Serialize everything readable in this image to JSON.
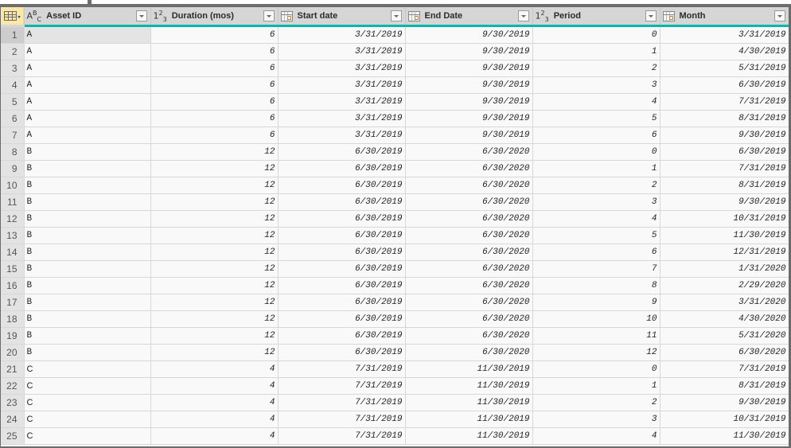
{
  "columns": [
    {
      "name": "Asset ID",
      "type_icon": "text-type-icon",
      "type_label": "ABC"
    },
    {
      "name": "Duration (mos)",
      "type_icon": "whole-number-type-icon",
      "type_label": "123"
    },
    {
      "name": "Start date",
      "type_icon": "date-type-icon",
      "type_label": ""
    },
    {
      "name": "End Date",
      "type_icon": "date-type-icon",
      "type_label": ""
    },
    {
      "name": "Period",
      "type_icon": "whole-number-type-icon",
      "type_label": "123"
    },
    {
      "name": "Month",
      "type_icon": "date-type-icon",
      "type_label": ""
    }
  ],
  "accent_color": "#01b8aa",
  "rows": [
    {
      "n": "1",
      "asset": "A",
      "duration": "6",
      "start": "3/31/2019",
      "end": "9/30/2019",
      "period": "0",
      "month": "3/31/2019"
    },
    {
      "n": "2",
      "asset": "A",
      "duration": "6",
      "start": "3/31/2019",
      "end": "9/30/2019",
      "period": "1",
      "month": "4/30/2019"
    },
    {
      "n": "3",
      "asset": "A",
      "duration": "6",
      "start": "3/31/2019",
      "end": "9/30/2019",
      "period": "2",
      "month": "5/31/2019"
    },
    {
      "n": "4",
      "asset": "A",
      "duration": "6",
      "start": "3/31/2019",
      "end": "9/30/2019",
      "period": "3",
      "month": "6/30/2019"
    },
    {
      "n": "5",
      "asset": "A",
      "duration": "6",
      "start": "3/31/2019",
      "end": "9/30/2019",
      "period": "4",
      "month": "7/31/2019"
    },
    {
      "n": "6",
      "asset": "A",
      "duration": "6",
      "start": "3/31/2019",
      "end": "9/30/2019",
      "period": "5",
      "month": "8/31/2019"
    },
    {
      "n": "7",
      "asset": "A",
      "duration": "6",
      "start": "3/31/2019",
      "end": "9/30/2019",
      "period": "6",
      "month": "9/30/2019"
    },
    {
      "n": "8",
      "asset": "B",
      "duration": "12",
      "start": "6/30/2019",
      "end": "6/30/2020",
      "period": "0",
      "month": "6/30/2019"
    },
    {
      "n": "9",
      "asset": "B",
      "duration": "12",
      "start": "6/30/2019",
      "end": "6/30/2020",
      "period": "1",
      "month": "7/31/2019"
    },
    {
      "n": "10",
      "asset": "B",
      "duration": "12",
      "start": "6/30/2019",
      "end": "6/30/2020",
      "period": "2",
      "month": "8/31/2019"
    },
    {
      "n": "11",
      "asset": "B",
      "duration": "12",
      "start": "6/30/2019",
      "end": "6/30/2020",
      "period": "3",
      "month": "9/30/2019"
    },
    {
      "n": "12",
      "asset": "B",
      "duration": "12",
      "start": "6/30/2019",
      "end": "6/30/2020",
      "period": "4",
      "month": "10/31/2019"
    },
    {
      "n": "13",
      "asset": "B",
      "duration": "12",
      "start": "6/30/2019",
      "end": "6/30/2020",
      "period": "5",
      "month": "11/30/2019"
    },
    {
      "n": "14",
      "asset": "B",
      "duration": "12",
      "start": "6/30/2019",
      "end": "6/30/2020",
      "period": "6",
      "month": "12/31/2019"
    },
    {
      "n": "15",
      "asset": "B",
      "duration": "12",
      "start": "6/30/2019",
      "end": "6/30/2020",
      "period": "7",
      "month": "1/31/2020"
    },
    {
      "n": "16",
      "asset": "B",
      "duration": "12",
      "start": "6/30/2019",
      "end": "6/30/2020",
      "period": "8",
      "month": "2/29/2020"
    },
    {
      "n": "17",
      "asset": "B",
      "duration": "12",
      "start": "6/30/2019",
      "end": "6/30/2020",
      "period": "9",
      "month": "3/31/2020"
    },
    {
      "n": "18",
      "asset": "B",
      "duration": "12",
      "start": "6/30/2019",
      "end": "6/30/2020",
      "period": "10",
      "month": "4/30/2020"
    },
    {
      "n": "19",
      "asset": "B",
      "duration": "12",
      "start": "6/30/2019",
      "end": "6/30/2020",
      "period": "11",
      "month": "5/31/2020"
    },
    {
      "n": "20",
      "asset": "B",
      "duration": "12",
      "start": "6/30/2019",
      "end": "6/30/2020",
      "period": "12",
      "month": "6/30/2020"
    },
    {
      "n": "21",
      "asset": "C",
      "duration": "4",
      "start": "7/31/2019",
      "end": "11/30/2019",
      "period": "0",
      "month": "7/31/2019"
    },
    {
      "n": "22",
      "asset": "C",
      "duration": "4",
      "start": "7/31/2019",
      "end": "11/30/2019",
      "period": "1",
      "month": "8/31/2019"
    },
    {
      "n": "23",
      "asset": "C",
      "duration": "4",
      "start": "7/31/2019",
      "end": "11/30/2019",
      "period": "2",
      "month": "9/30/2019"
    },
    {
      "n": "24",
      "asset": "C",
      "duration": "4",
      "start": "7/31/2019",
      "end": "11/30/2019",
      "period": "3",
      "month": "10/31/2019"
    },
    {
      "n": "25",
      "asset": "C",
      "duration": "4",
      "start": "7/31/2019",
      "end": "11/30/2019",
      "period": "4",
      "month": "11/30/2019"
    }
  ]
}
